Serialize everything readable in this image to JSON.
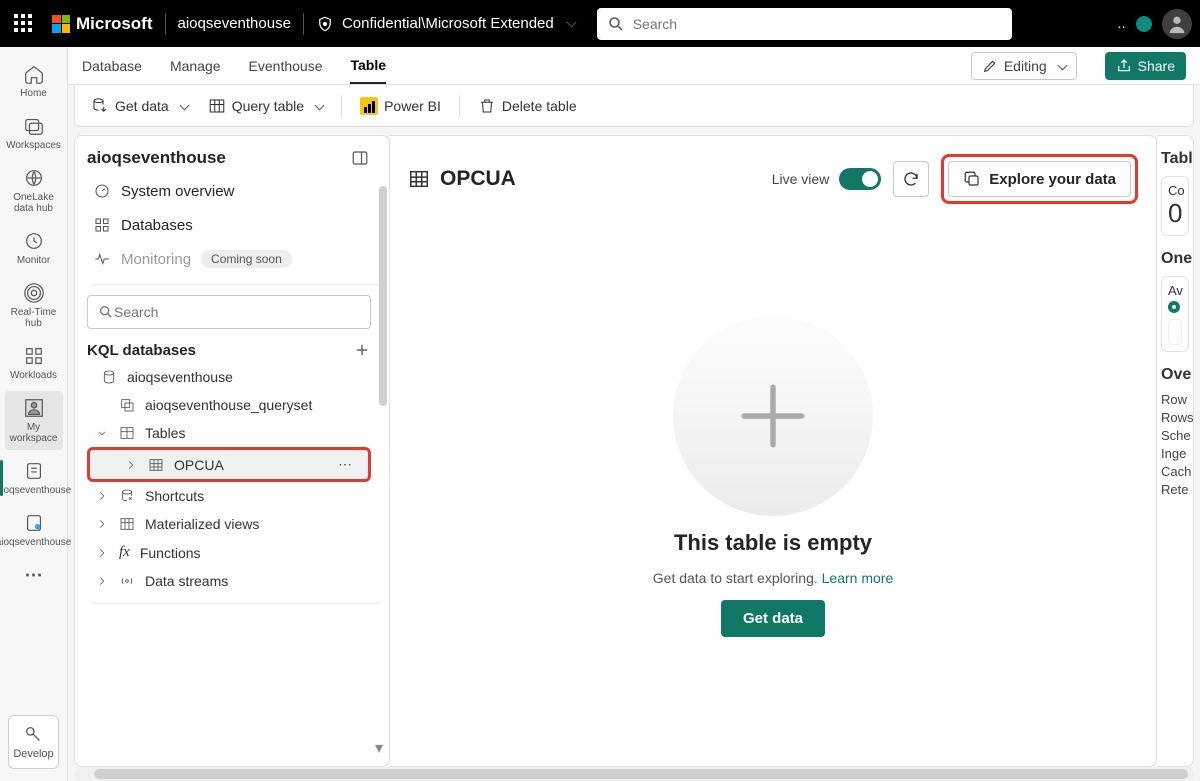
{
  "topbar": {
    "brand": "Microsoft",
    "workspace": "aioqseventhouse",
    "sensitivity": "Confidential\\Microsoft Extended",
    "search_placeholder": "Search"
  },
  "rail": {
    "items": [
      {
        "id": "home",
        "label": "Home"
      },
      {
        "id": "workspaces",
        "label": "Workspaces"
      },
      {
        "id": "onelake",
        "label": "OneLake data hub"
      },
      {
        "id": "monitor",
        "label": "Monitor"
      },
      {
        "id": "rth",
        "label": "Real-Time hub"
      },
      {
        "id": "workloads",
        "label": "Workloads"
      },
      {
        "id": "mywks",
        "label": "My workspace"
      },
      {
        "id": "evh",
        "label": "aioqseventhouse"
      },
      {
        "id": "evh2",
        "label": "aioqseventhouse"
      }
    ],
    "develop": "Develop"
  },
  "tabs": {
    "items": [
      "Database",
      "Manage",
      "Eventhouse",
      "Table"
    ],
    "active": "Table",
    "edit": "Editing",
    "share": "Share"
  },
  "toolbar": {
    "get_data": "Get data",
    "query_table": "Query table",
    "power_bi": "Power BI",
    "delete_table": "Delete table"
  },
  "tree": {
    "title": "aioqseventhouse",
    "nav": {
      "system_overview": "System overview",
      "databases": "Databases",
      "monitoring": "Monitoring",
      "coming_soon": "Coming soon"
    },
    "search_placeholder": "Search",
    "section": "KQL databases",
    "db": "aioqseventhouse",
    "queryset": "aioqseventhouse_queryset",
    "folders": {
      "tables": "Tables",
      "opcua": "OPCUA",
      "shortcuts": "Shortcuts",
      "mat_views": "Materialized views",
      "functions": "Functions",
      "data_streams": "Data streams"
    }
  },
  "canvas": {
    "title": "OPCUA",
    "live_view": "Live view",
    "explore": "Explore your data",
    "empty_title": "This table is empty",
    "empty_sub": "Get data to start exploring. ",
    "learn_more": "Learn more",
    "get_data": "Get data"
  },
  "rpanel": {
    "table_details": "Tabl",
    "zero": "0",
    "co": "Co",
    "onelake": "One",
    "av": "Av",
    "overview": "Ove",
    "rows": [
      "Row",
      "Rows",
      "Sche",
      "Inge",
      "Cach",
      "Rete"
    ]
  }
}
